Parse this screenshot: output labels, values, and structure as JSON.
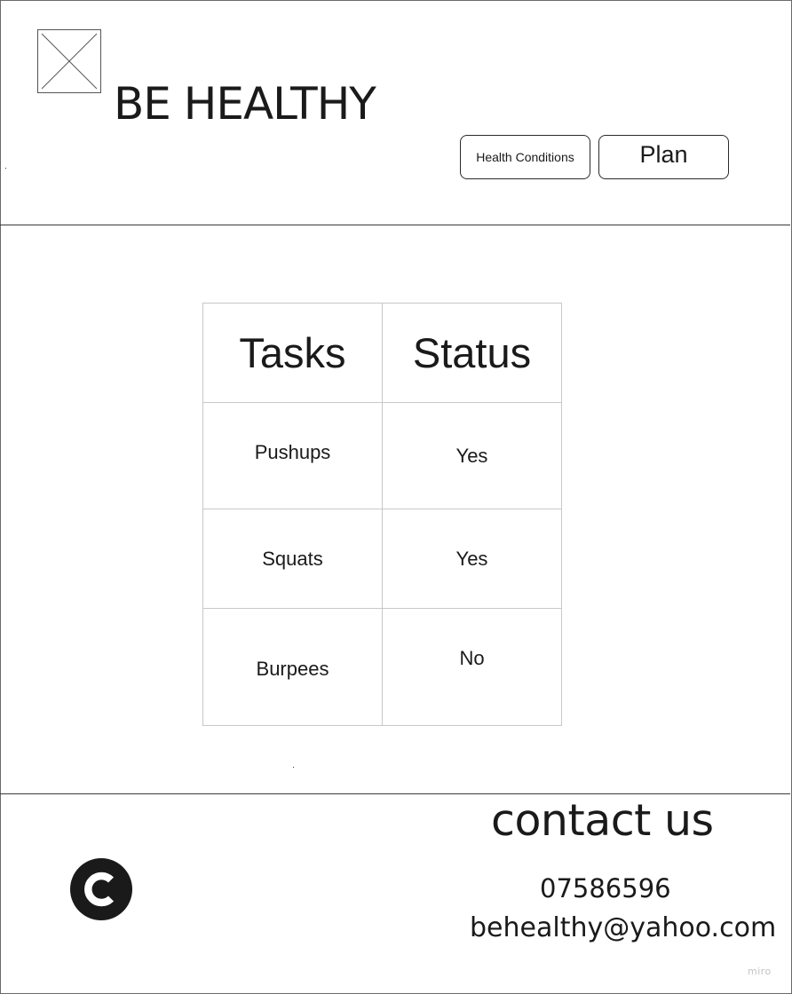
{
  "header": {
    "logo_icon": "image-placeholder-icon",
    "title": "BE HEALTHY",
    "nav": {
      "health_conditions_label": "Health Conditions",
      "plan_label": "Plan"
    }
  },
  "main": {
    "table": {
      "headers": [
        "Tasks",
        "Status"
      ],
      "rows": [
        {
          "task": "Pushups",
          "status": "Yes"
        },
        {
          "task": "Squats",
          "status": "Yes"
        },
        {
          "task": "Burpees",
          "status": "No"
        }
      ]
    }
  },
  "footer": {
    "copyright_icon": "copyright-icon",
    "contact_title": "contact us",
    "phone": "07586596",
    "email": "behealthy@yahoo.com"
  },
  "watermark": "miro",
  "colors": {
    "text": "#1a1a1a",
    "table_border": "#c8c8c8",
    "divider": "#3a3a3a",
    "watermark": "#c4c4c4"
  }
}
